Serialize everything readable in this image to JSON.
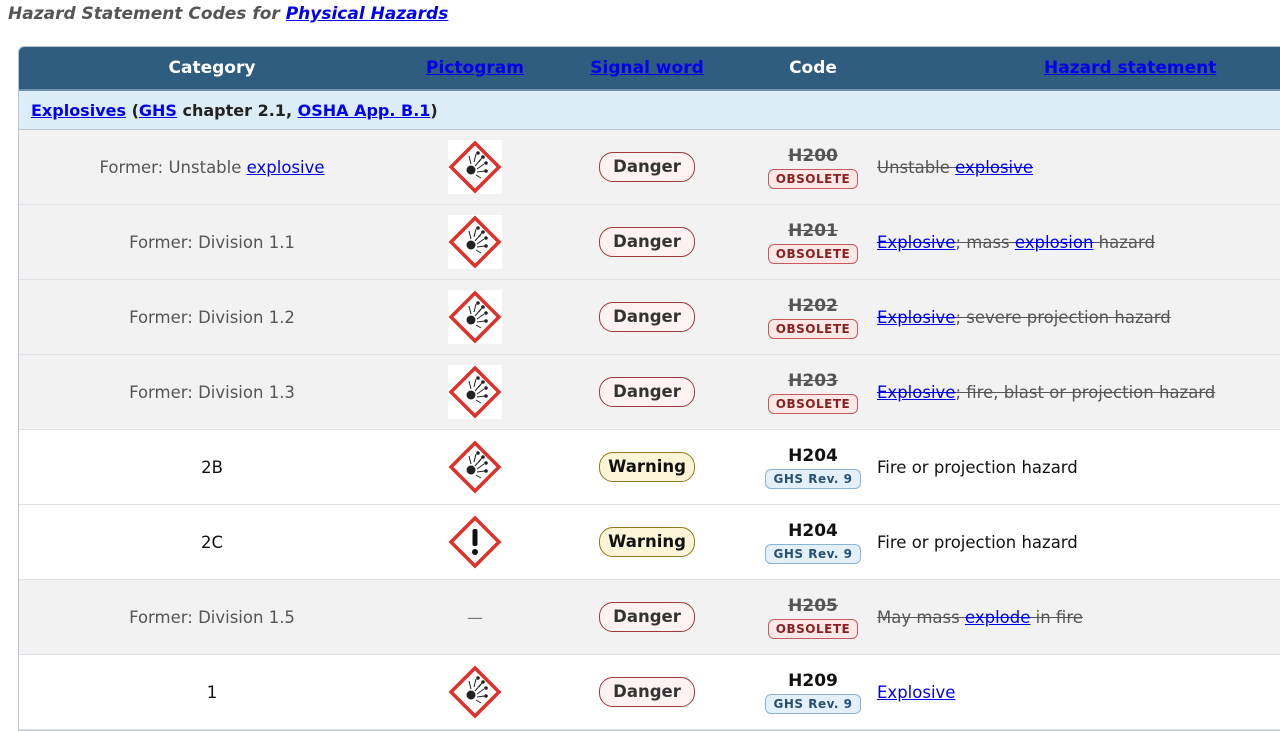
{
  "page_title": {
    "prefix": "Hazard Statement Codes for",
    "link": "Physical Hazards"
  },
  "headers": {
    "category": "Category",
    "pictogram": "Pictogram",
    "signal": "Signal word",
    "code": "Code",
    "hazard": "Hazard statement"
  },
  "group": {
    "name": "Explosives",
    "ghs": "GHS",
    "chapter": " chapter 2.1, ",
    "osha": "OSHA App. B.1"
  },
  "rows": [
    {
      "category_prefix": "Former: Unstable ",
      "category_link": "explosive",
      "pictogram": "exploding-bomb",
      "signal": "Danger",
      "code": "H200",
      "badge": "OBSOLETE",
      "statement": [
        {
          "t": "Unstable "
        },
        {
          "a": "explosive"
        }
      ]
    },
    {
      "category_prefix": "Former: Division 1.1",
      "pictogram": "exploding-bomb",
      "signal": "Danger",
      "code": "H201",
      "badge": "OBSOLETE",
      "statement": [
        {
          "a": "Explosive"
        },
        {
          "t": "; mass "
        },
        {
          "a": "explosion"
        },
        {
          "t": " hazard"
        }
      ]
    },
    {
      "category_prefix": "Former: Division 1.2",
      "pictogram": "exploding-bomb",
      "signal": "Danger",
      "code": "H202",
      "badge": "OBSOLETE",
      "statement": [
        {
          "a": "Explosive"
        },
        {
          "t": "; severe projection hazard"
        }
      ]
    },
    {
      "category_prefix": "Former: Division 1.3",
      "pictogram": "exploding-bomb",
      "signal": "Danger",
      "code": "H203",
      "badge": "OBSOLETE",
      "statement": [
        {
          "a": "Explosive"
        },
        {
          "t": "; fire, blast or projection hazard"
        }
      ]
    },
    {
      "category_prefix": "2B",
      "pictogram": "exploding-bomb",
      "signal": "Warning",
      "code": "H204",
      "badge": "GHS Rev. 9",
      "statement": [
        {
          "t": "Fire or projection hazard"
        }
      ]
    },
    {
      "category_prefix": "2C",
      "pictogram": "exclamation-mark",
      "signal": "Warning",
      "code": "H204",
      "badge": "GHS Rev. 9",
      "statement": [
        {
          "t": "Fire or projection hazard"
        }
      ]
    },
    {
      "category_prefix": "Former: Division 1.5",
      "pictogram": "none",
      "pictogram_text": "—",
      "signal": "Danger",
      "code": "H205",
      "badge": "OBSOLETE",
      "statement": [
        {
          "t": "May mass "
        },
        {
          "a": "explode"
        },
        {
          "t": " in fire"
        }
      ]
    },
    {
      "category_prefix": "1",
      "pictogram": "exploding-bomb",
      "signal": "Danger",
      "code": "H209",
      "badge": "GHS Rev. 9",
      "statement": [
        {
          "a": "Explosive"
        }
      ]
    }
  ],
  "colors": {
    "header_bg": "#2f5d80",
    "group_bg": "#dcedf7",
    "obsolete_row_bg": "#f2f2f2",
    "pictogram_red": "#e0302b"
  }
}
